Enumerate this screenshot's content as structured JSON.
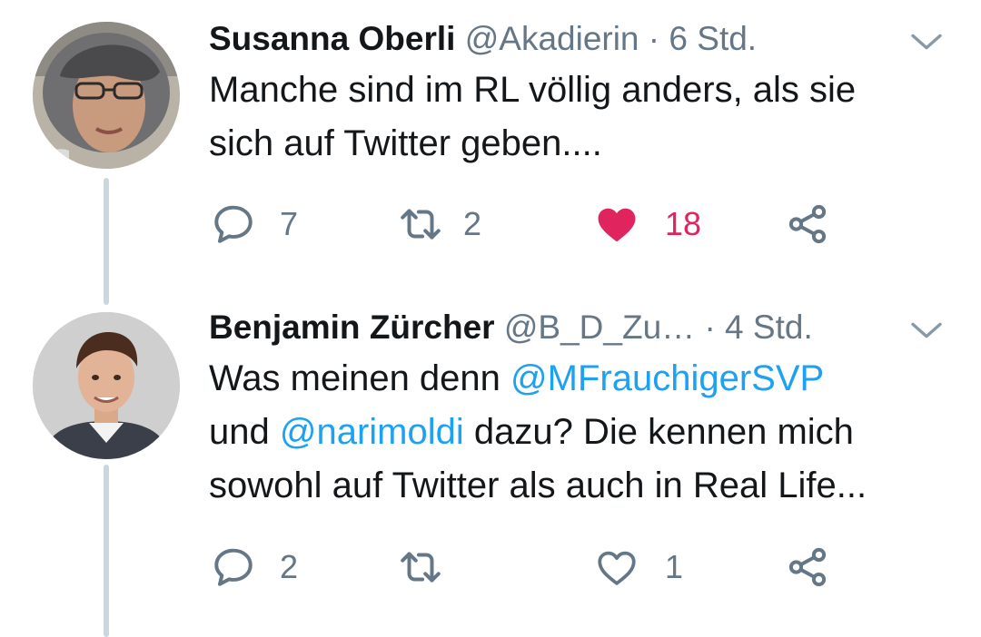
{
  "colors": {
    "text": "#14171a",
    "secondary": "#657786",
    "link": "#1da1f2",
    "like": "#e0245e",
    "thread_line": "#ccd6dd"
  },
  "tweets": [
    {
      "name": "Susanna Oberli",
      "handle": "@Akadierin",
      "separator": "·",
      "time": "6 Std.",
      "text_lines": [
        "Manche sind im RL völlig anders, als sie",
        "sich auf Twitter geben...."
      ],
      "actions": {
        "reply": {
          "icon": "reply-icon",
          "count": "7"
        },
        "retweet": {
          "icon": "retweet-icon",
          "count": "2"
        },
        "like": {
          "icon": "heart-filled-icon",
          "count": "18",
          "liked": true
        },
        "share": {
          "icon": "share-icon"
        }
      }
    },
    {
      "name": "Benjamin Zürcher",
      "handle": "@B_D_Zu…",
      "separator": "·",
      "time": "4 Std.",
      "text": {
        "line1_pre": "Was meinen denn ",
        "mention1": "@MFrauchigerSVP",
        "line2_pre": "und ",
        "mention2": "@narimoldi",
        "line2_post": " dazu? Die kennen mich",
        "line3": "sowohl auf Twitter als auch in Real Life..."
      },
      "actions": {
        "reply": {
          "icon": "reply-icon",
          "count": "2"
        },
        "retweet": {
          "icon": "retweet-icon",
          "count": ""
        },
        "like": {
          "icon": "heart-outline-icon",
          "count": "1",
          "liked": false
        },
        "share": {
          "icon": "share-icon"
        }
      }
    }
  ]
}
